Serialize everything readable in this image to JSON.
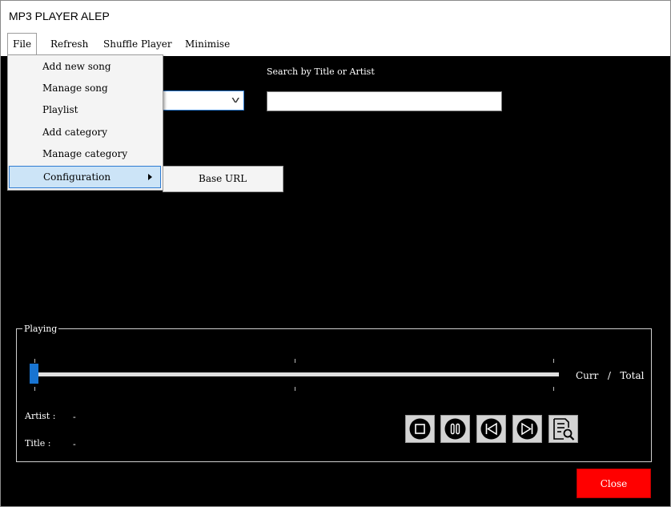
{
  "window": {
    "title": "MP3 PLAYER ALEP"
  },
  "menubar": {
    "items": [
      {
        "label": "File"
      },
      {
        "label": "Refresh"
      },
      {
        "label": "Shuffle Player"
      },
      {
        "label": "Minimise"
      }
    ]
  },
  "file_menu": {
    "items": [
      {
        "label": "Add new song"
      },
      {
        "label": "Manage song"
      },
      {
        "label": "Playlist"
      },
      {
        "label": "Add category"
      },
      {
        "label": "Manage category"
      },
      {
        "label": "Configuration"
      }
    ]
  },
  "configuration_submenu": {
    "items": [
      {
        "label": "Base URL"
      }
    ]
  },
  "search": {
    "label": "Search by Title or Artist",
    "value": "",
    "placeholder": ""
  },
  "category_combo": {
    "value": ""
  },
  "playing": {
    "group_label": "Playing",
    "progress": 0,
    "curr_label": "Curr",
    "separator": "/",
    "total_label": "Total",
    "artist_label": "Artist :",
    "artist_value": "-",
    "title_label": "Title :",
    "title_value": "-"
  },
  "controls": {
    "icons": [
      "stop-icon",
      "pause-icon",
      "previous-icon",
      "next-icon",
      "lyrics-search-icon"
    ]
  },
  "close_button": {
    "label": "Close"
  },
  "colors": {
    "background": "#000000",
    "close_button": "#ff0000",
    "slider_thumb": "#1874d2",
    "menu_highlight": "#cce4f7"
  }
}
